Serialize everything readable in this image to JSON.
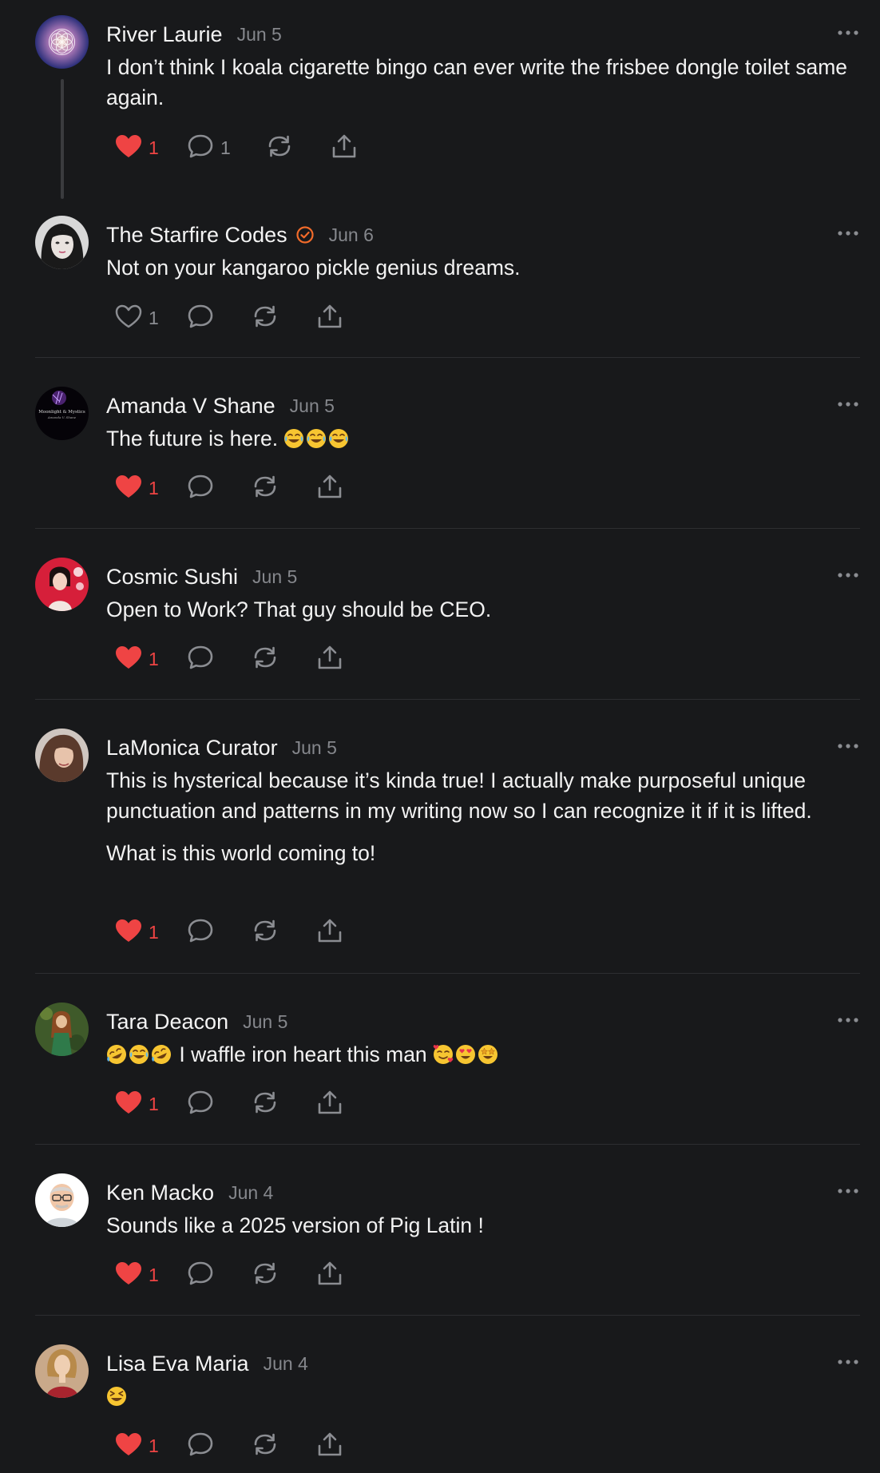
{
  "comments": [
    {
      "author": "River Laurie",
      "date": "Jun 5",
      "text": [
        "I don’t think I koala cigarette bingo can ever write the frisbee dongle toilet same again."
      ],
      "likes": "1",
      "replies": "1",
      "liked": true
    },
    {
      "author": "The Starfire Codes",
      "verified": true,
      "date": "Jun 6",
      "text": [
        "Not on your kangaroo pickle genius dreams."
      ],
      "likes": "1",
      "liked": false
    },
    {
      "author": "Amanda V Shane",
      "date": "Jun 5",
      "text_prefix": "The future is here. ",
      "emojis": [
        "joy-emoji",
        "joy-emoji",
        "joy-emoji"
      ],
      "likes": "1",
      "liked": true
    },
    {
      "author": "Cosmic Sushi",
      "date": "Jun 5",
      "text": [
        "Open to Work? That guy should be CEO."
      ],
      "likes": "1",
      "liked": true
    },
    {
      "author": "LaMonica Curator",
      "date": "Jun 5",
      "text": [
        "This is hysterical because it’s kinda true! I actually make purposeful unique punctuation and patterns in my writing now so I can recognize it if it is lifted.",
        "What is this world coming to!"
      ],
      "likes": "1",
      "liked": true
    },
    {
      "author": "Tara Deacon",
      "date": "Jun 5",
      "emojis_before": [
        "rofl-emoji",
        "joy-emoji",
        "rofl-emoji"
      ],
      "text_mid": " I waffle iron heart this man ",
      "emojis_after": [
        "smiling-hearts-emoji",
        "heart-eyes-emoji",
        "star-struck-emoji"
      ],
      "likes": "1",
      "liked": true
    },
    {
      "author": "Ken Macko",
      "date": "Jun 4",
      "text": [
        "Sounds like a 2025 version of Pig Latin !"
      ],
      "likes": "1",
      "liked": true
    },
    {
      "author": "Lisa Eva Maria",
      "date": "Jun 4",
      "emojis": [
        "laughing-emoji"
      ],
      "likes": "1",
      "liked": true
    }
  ],
  "avatar_art": {
    "amanda_logo_line1": "Moonlight & Mystics",
    "amanda_logo_line2": "Amanda V. Shane"
  },
  "colors": {
    "background": "#18191b",
    "like_red": "#ef4444",
    "verified_orange": "#f26b2a",
    "muted": "#85878c"
  }
}
